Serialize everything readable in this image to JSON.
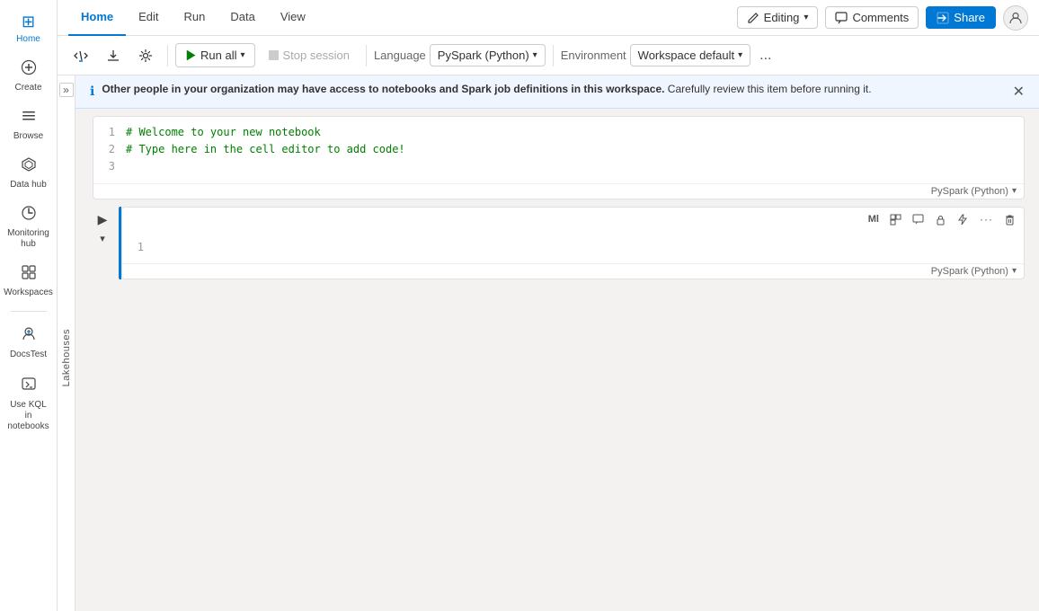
{
  "sidebar": {
    "items": [
      {
        "id": "home",
        "icon": "⊞",
        "label": "Home",
        "active": true
      },
      {
        "id": "create",
        "icon": "+",
        "label": "Create",
        "active": false
      },
      {
        "id": "browse",
        "icon": "☰",
        "label": "Browse",
        "active": false
      },
      {
        "id": "datahub",
        "icon": "⬡",
        "label": "Data hub",
        "active": false
      },
      {
        "id": "monitoring",
        "icon": "◷",
        "label": "Monitoring hub",
        "active": false
      },
      {
        "id": "workspaces",
        "icon": "⊡",
        "label": "Workspaces",
        "active": false
      },
      {
        "id": "docstest",
        "icon": "⛭",
        "label": "DocsTest",
        "active": false
      },
      {
        "id": "kql",
        "icon": "⌸",
        "label": "Use KQL in notebooks",
        "active": false
      }
    ]
  },
  "topbar": {
    "tabs": [
      "Home",
      "Edit",
      "Run",
      "Data",
      "View"
    ],
    "active_tab": "Home",
    "editing_label": "Editing",
    "comments_label": "Comments",
    "share_label": "Share"
  },
  "ribbon": {
    "add_code_tooltip": "Add code cell",
    "import_tooltip": "Import",
    "settings_tooltip": "Settings",
    "run_all_label": "Run all",
    "stop_session_label": "Stop session",
    "language_label": "Language",
    "language_value": "PySpark (Python)",
    "environment_label": "Environment",
    "environment_value": "Workspace default",
    "more_label": "..."
  },
  "info_banner": {
    "bold_text": "Other people in your organization may have access to notebooks and Spark job definitions in this workspace.",
    "rest_text": " Carefully review this item before running it."
  },
  "lakehouses_panel": {
    "label": "Lakehouses"
  },
  "cells": [
    {
      "id": "cell1",
      "lines": [
        {
          "num": 1,
          "code": "# Welcome to your new notebook",
          "type": "comment"
        },
        {
          "num": 2,
          "code": "# Type here in the cell editor to add code!",
          "type": "comment"
        },
        {
          "num": 3,
          "code": "",
          "type": "normal"
        }
      ],
      "language": "PySpark (Python)",
      "has_toolbar": false,
      "active_border": false
    },
    {
      "id": "cell2",
      "lines": [
        {
          "num": 1,
          "code": "",
          "type": "normal"
        }
      ],
      "language": "PySpark (Python)",
      "has_toolbar": true,
      "active_border": true
    }
  ],
  "cell2_toolbar": {
    "buttons": [
      "Ml",
      "⬚",
      "⬜",
      "🔒",
      "✳",
      "...",
      "🗑"
    ]
  }
}
